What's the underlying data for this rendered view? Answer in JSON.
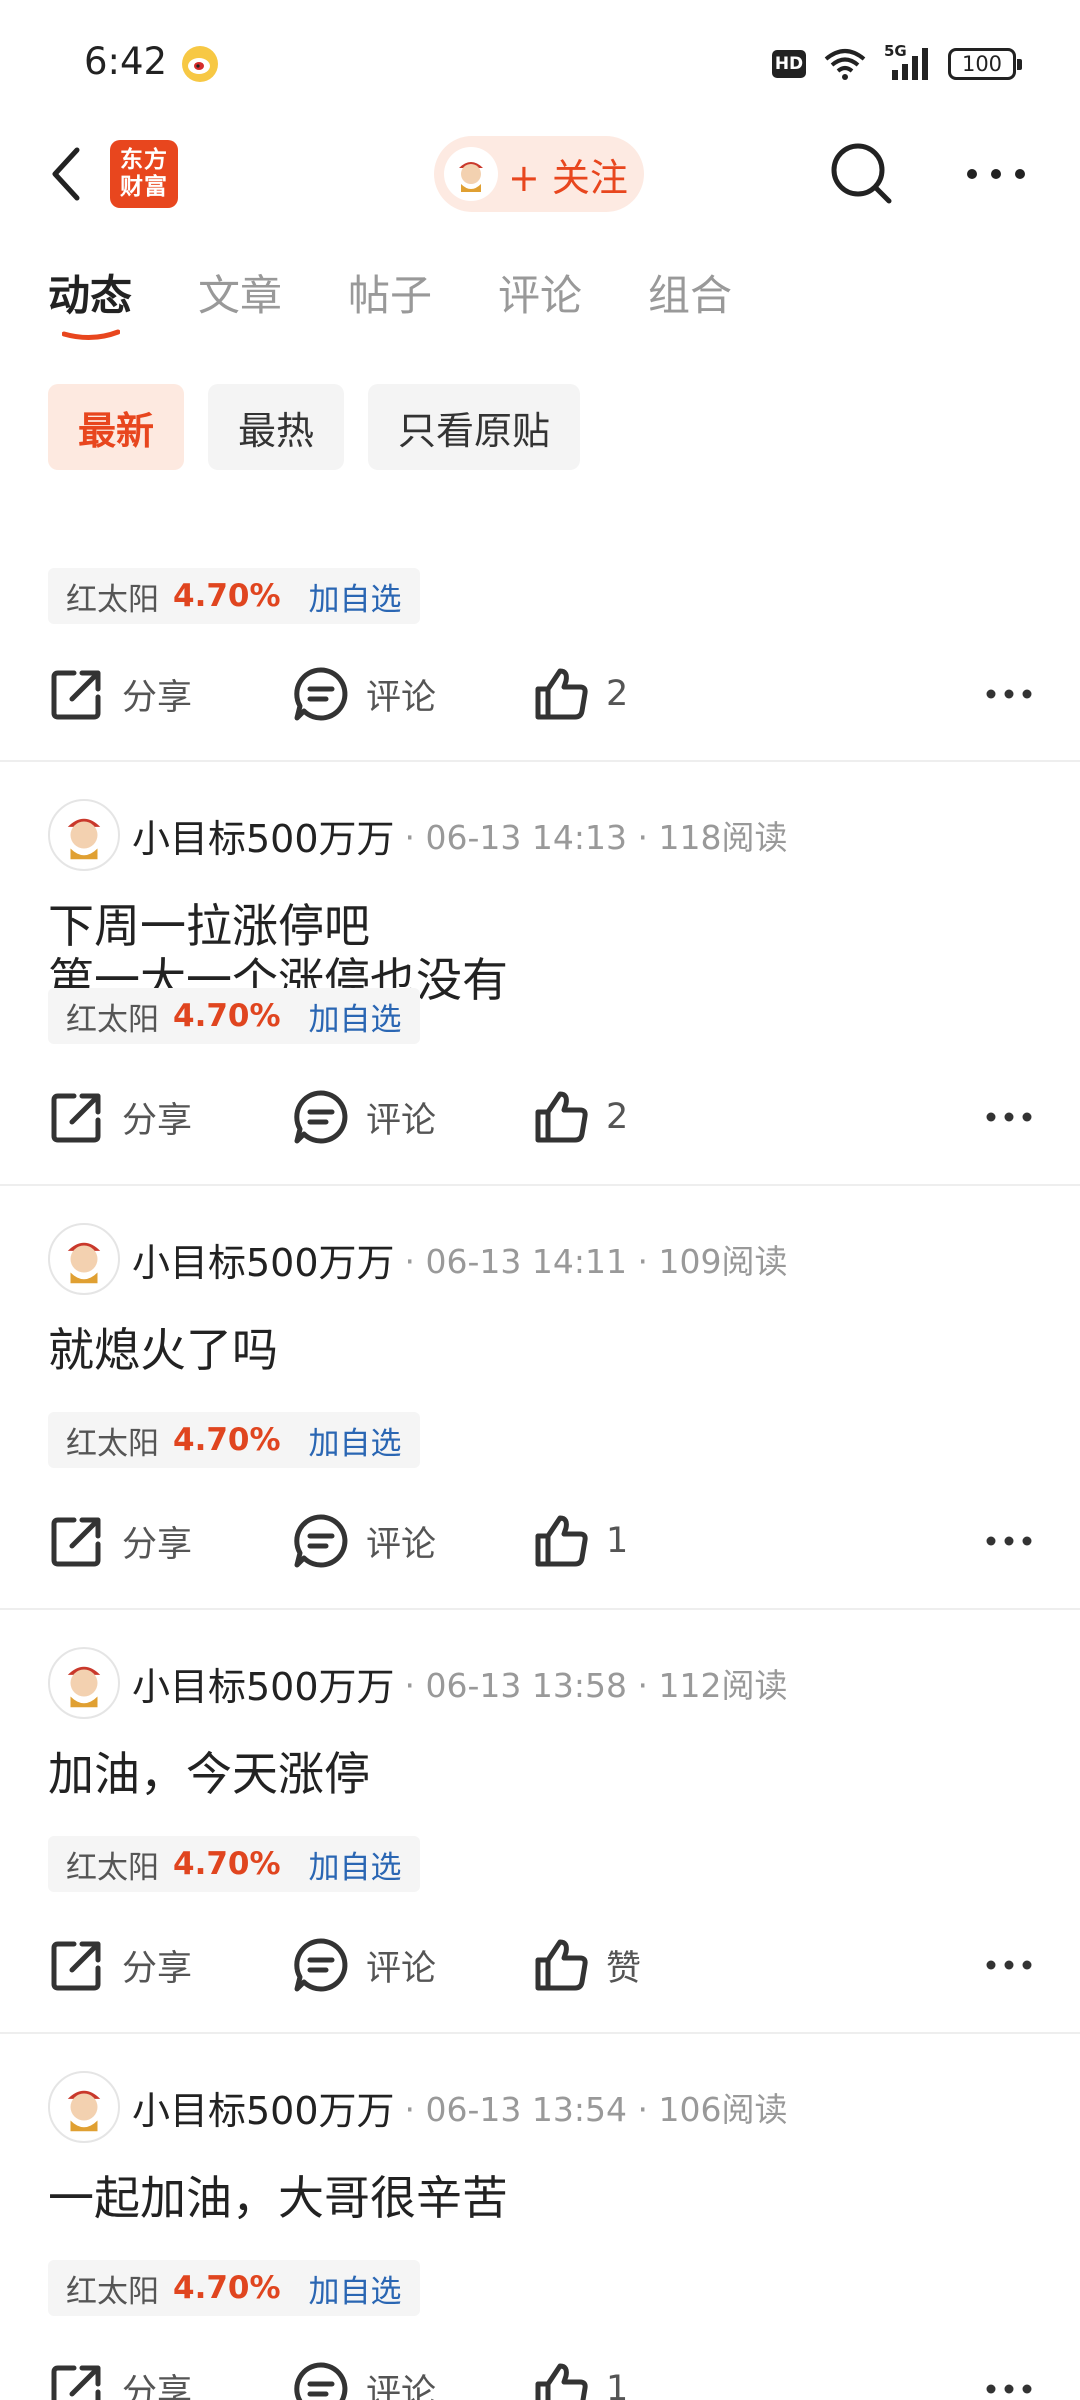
{
  "status_bar": {
    "time": "6:42",
    "network": "5G",
    "battery": "100"
  },
  "header": {
    "brand_logo_line1": "东方",
    "brand_logo_line2": "财富",
    "follow_label": "+ 关注"
  },
  "tabs": [
    {
      "label": "动态",
      "active": true
    },
    {
      "label": "文章",
      "active": false
    },
    {
      "label": "帖子",
      "active": false
    },
    {
      "label": "评论",
      "active": false
    },
    {
      "label": "组合",
      "active": false
    }
  ],
  "filters": [
    {
      "label": "最新",
      "active": true
    },
    {
      "label": "最热",
      "active": false
    },
    {
      "label": "只看原贴",
      "active": false
    }
  ],
  "action_labels": {
    "share": "分享",
    "comment": "评论"
  },
  "stock": {
    "name": "红太阳",
    "change": "4.70%",
    "add_label": "加自选"
  },
  "posts": [
    {
      "author": "",
      "meta": "",
      "text": "第一大一个涨停也没有",
      "likes": "2"
    },
    {
      "author": "小目标500万万",
      "meta": "· 06-13 14:13 · 118阅读",
      "text": "下周一拉涨停吧",
      "likes": "2"
    },
    {
      "author": "小目标500万万",
      "meta": "· 06-13 14:11 · 109阅读",
      "text": "就熄火了吗",
      "likes": "1"
    },
    {
      "author": "小目标500万万",
      "meta": "· 06-13 13:58 · 112阅读",
      "text": "加油，今天涨停",
      "likes": "赞"
    },
    {
      "author": "小目标500万万",
      "meta": "· 06-13 13:54 · 106阅读",
      "text": "一起加油，大哥很辛苦",
      "likes": "1"
    }
  ],
  "colors": {
    "accent": "#e8461e",
    "link": "#2a66b3",
    "stock_up": "#e0451f"
  }
}
